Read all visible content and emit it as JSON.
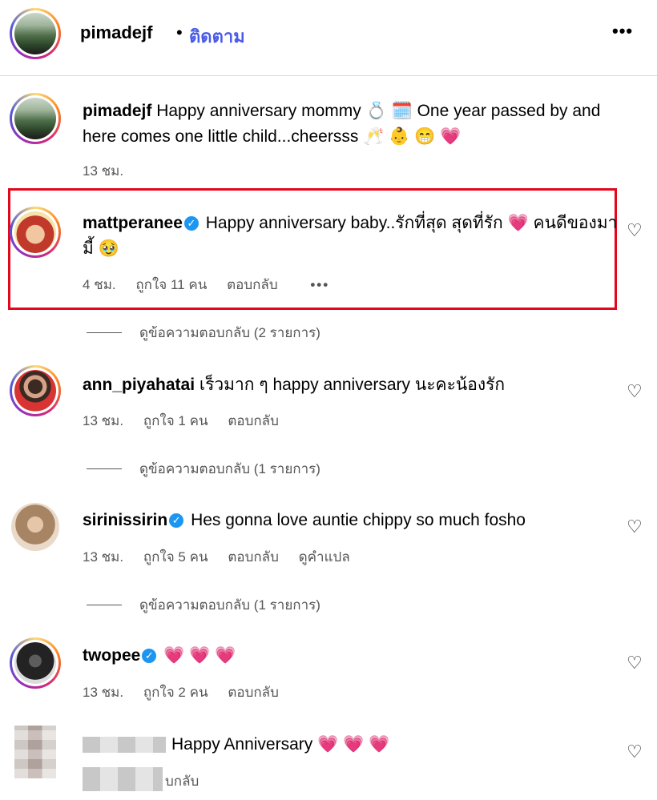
{
  "header": {
    "username": "pimadejf",
    "separator": "•",
    "follow_label": "ติดตาม",
    "more_icon": "•••"
  },
  "comments": [
    {
      "username": "pimadejf",
      "verified": false,
      "text": "Happy anniversary mommy 💍 🗓️ One year passed by and here comes one little child...cheersss 🥂 👶 😁 💗",
      "time": "13 ชม."
    },
    {
      "username": "mattperanee",
      "verified": true,
      "text": "Happy anniversary baby..รักที่สุด สุดที่รัก 💗 คนดีของมามี้ 🥹",
      "time": "4 ชม.",
      "likes": "ถูกใจ 11 คน",
      "reply": "ตอบกลับ",
      "more": "•••",
      "replies_label": "ดูข้อความตอบกลับ (2 รายการ)"
    },
    {
      "username": "ann_piyahatai",
      "verified": false,
      "text": "เร็วมาก ๆ happy anniversary นะคะน้องรัก",
      "time": "13 ชม.",
      "likes": "ถูกใจ 1 คน",
      "reply": "ตอบกลับ",
      "replies_label": "ดูข้อความตอบกลับ (1 รายการ)"
    },
    {
      "username": "sirinissirin",
      "verified": true,
      "text": "Hes gonna love auntie chippy so much fosho",
      "time": "13 ชม.",
      "likes": "ถูกใจ 5 คน",
      "reply": "ตอบกลับ",
      "translate": "ดูคำแปล",
      "replies_label": "ดูข้อความตอบกลับ (1 รายการ)"
    },
    {
      "username": "twopee",
      "verified": true,
      "text": "💗 💗 💗",
      "time": "13 ชม.",
      "likes": "ถูกใจ 2 คน",
      "reply": "ตอบกลับ"
    },
    {
      "username": "",
      "verified": false,
      "text": "Happy Anniversary 💗 💗 💗",
      "reply_partial": "บกลับ"
    }
  ],
  "colors": {
    "follow": "#4a5be8",
    "highlight_border": "#e3061c",
    "verified": "#1c96f0"
  },
  "icons": {
    "heart": "♡",
    "check": "✓"
  }
}
